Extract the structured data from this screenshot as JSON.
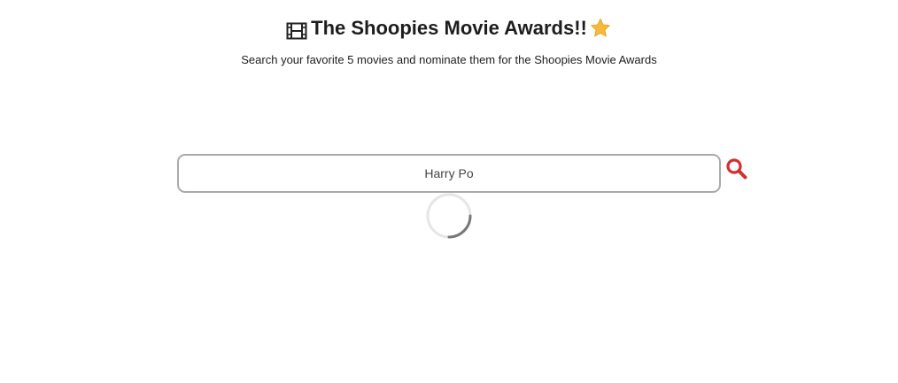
{
  "header": {
    "title": "The Shoopies Movie Awards!!",
    "subtitle": "Search your favorite 5 movies and nominate them for the Shoopies Movie Awards",
    "title_icon_left": "film-icon",
    "title_icon_right": "star-icon"
  },
  "search": {
    "value": "Harry Po",
    "button_icon": "search-icon"
  },
  "status": {
    "loading_icon": "spinner-icon"
  },
  "colors": {
    "accent": "#d32f2f",
    "star": "#f6b93b",
    "border": "#aaaaaa"
  }
}
